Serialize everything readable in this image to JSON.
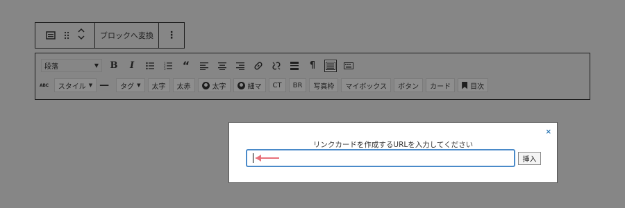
{
  "block_toolbar": {
    "block_type_icon": "paragraph-block-icon",
    "drag_icon": "drag-handle-icon",
    "move_icon": "move-up-down-icon",
    "transform_label": "ブロックへ変換",
    "more_label": "⋮"
  },
  "classic_toolbar": {
    "row1": {
      "format_select": "段落",
      "icons": [
        "bold-icon",
        "italic-icon",
        "bullet-list-icon",
        "numbered-list-icon",
        "blockquote-icon",
        "align-left-icon",
        "align-center-icon",
        "align-right-icon",
        "link-icon",
        "unlink-icon",
        "read-more-icon",
        "paste-text-icon",
        "toolbar-toggle-icon",
        "keyboard-icon"
      ]
    },
    "row2": {
      "abc_label": "ABC",
      "style_label": "スタイル",
      "hr_label": "—",
      "tag_label": "タグ",
      "buttons": [
        "太字",
        "太赤"
      ],
      "bold_user_label": "太字",
      "thin_user_label": "細マ",
      "ct_label": "CT",
      "br_label": "BR",
      "photo_frame_label": "写真枠",
      "my_box_label": "マイボックス",
      "button_label": "ボタン",
      "card_label": "カード",
      "toc_label": "目次"
    }
  },
  "modal": {
    "close_label": "×",
    "message": "リンクカードを作成するURLを入力してください",
    "input_value": "",
    "insert_label": "挿入",
    "accent_color": "#4a8ac9",
    "arrow_color": "#e8707a"
  }
}
